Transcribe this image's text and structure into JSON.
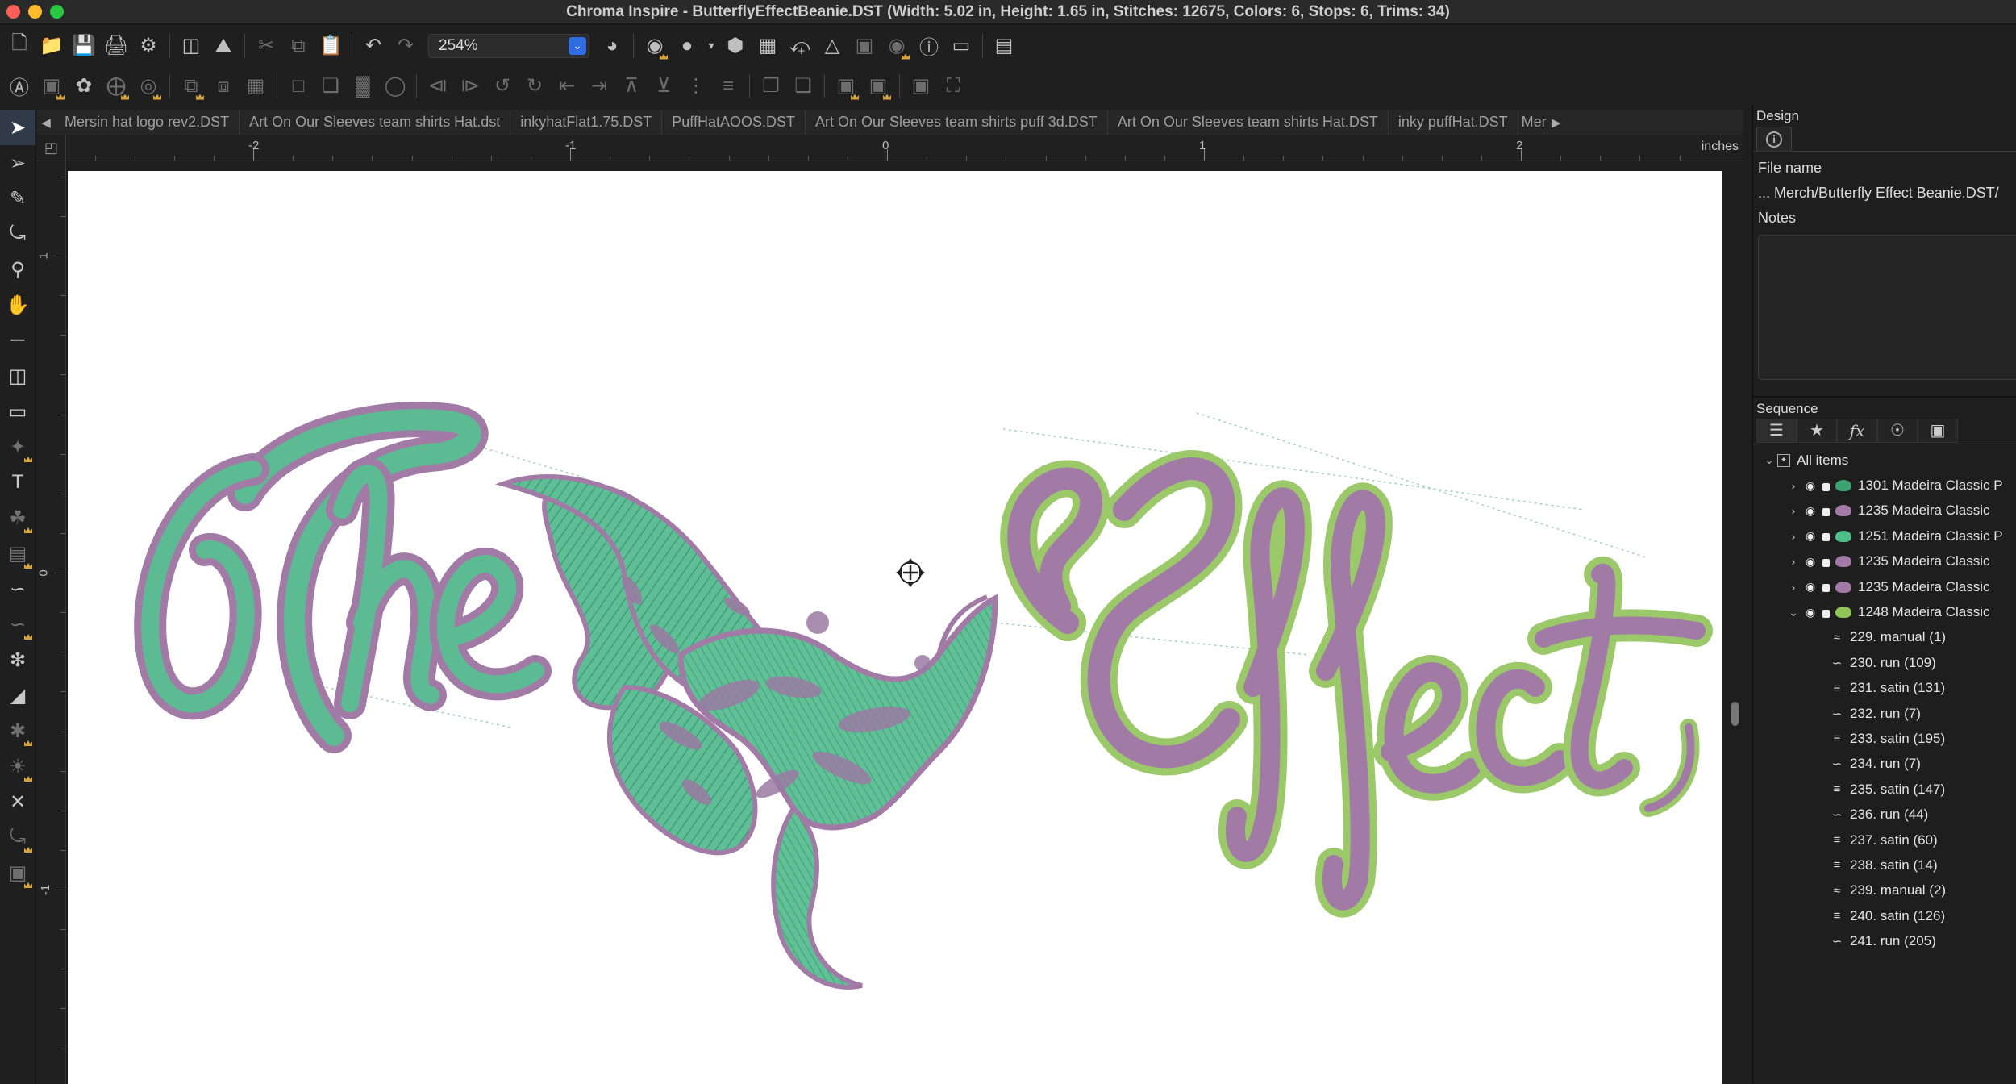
{
  "window": {
    "title": "Chroma Inspire - ButterflyEffectBeanie.DST (Width: 5.02 in, Height: 1.65 in, Stitches: 12675, Colors: 6, Stops: 6, Trims: 34)"
  },
  "toolbar": {
    "zoom_value": "254%"
  },
  "tabs": [
    "Mersin hat logo rev2.DST",
    "Art On Our Sleeves team shirts Hat.dst",
    "inkyhatFlat1.75.DST",
    "PuffHatAOOS.DST",
    "Art On Our Sleeves team shirts puff 3d.DST",
    "Art On Our Sleeves team shirts Hat.DST",
    "inky puffHat.DST",
    "Merc"
  ],
  "ruler": {
    "units": "inches",
    "h_labels": [
      "-2",
      "-1",
      "0",
      "1",
      "2"
    ],
    "v_labels": [
      "1",
      "0",
      "-1"
    ]
  },
  "design_panel": {
    "title": "Design",
    "file_name_label": "File name",
    "file_name_value": "... Merch/Butterfly Effect Beanie.DST/",
    "notes_label": "Notes"
  },
  "sequence_panel": {
    "title": "Sequence",
    "root_label": "All items",
    "color_items": [
      {
        "label": "1301 Madeira Classic P",
        "color": "#3aa370",
        "expanded": false
      },
      {
        "label": "1235 Madeira Classic",
        "color": "#a27aa6",
        "expanded": false
      },
      {
        "label": "1251 Madeira Classic P",
        "color": "#4fbf8a",
        "expanded": false
      },
      {
        "label": "1235 Madeira Classic",
        "color": "#a27aa6",
        "expanded": false
      },
      {
        "label": "1235 Madeira Classic",
        "color": "#a27aa6",
        "expanded": false
      },
      {
        "label": "1248 Madeira Classic",
        "color": "#8fc655",
        "expanded": true
      }
    ],
    "sub_items": [
      {
        "label": "229. manual (1)",
        "type": "manual"
      },
      {
        "label": "230. run (109)",
        "type": "run"
      },
      {
        "label": "231. satin (131)",
        "type": "satin"
      },
      {
        "label": "232. run (7)",
        "type": "run"
      },
      {
        "label": "233. satin (195)",
        "type": "satin"
      },
      {
        "label": "234. run (7)",
        "type": "run"
      },
      {
        "label": "235. satin (147)",
        "type": "satin"
      },
      {
        "label": "236. run (44)",
        "type": "run"
      },
      {
        "label": "237. satin (60)",
        "type": "satin"
      },
      {
        "label": "238. satin (14)",
        "type": "satin"
      },
      {
        "label": "239. manual (2)",
        "type": "manual"
      },
      {
        "label": "240. satin (126)",
        "type": "satin"
      },
      {
        "label": "241. run (205)",
        "type": "run"
      }
    ]
  },
  "design": {
    "text_left": "The",
    "text_right": "Effect",
    "colors": {
      "green_fill": "#5dbb93",
      "purple_outline": "#a27aa6",
      "lime_outline": "#9bc96a"
    }
  }
}
